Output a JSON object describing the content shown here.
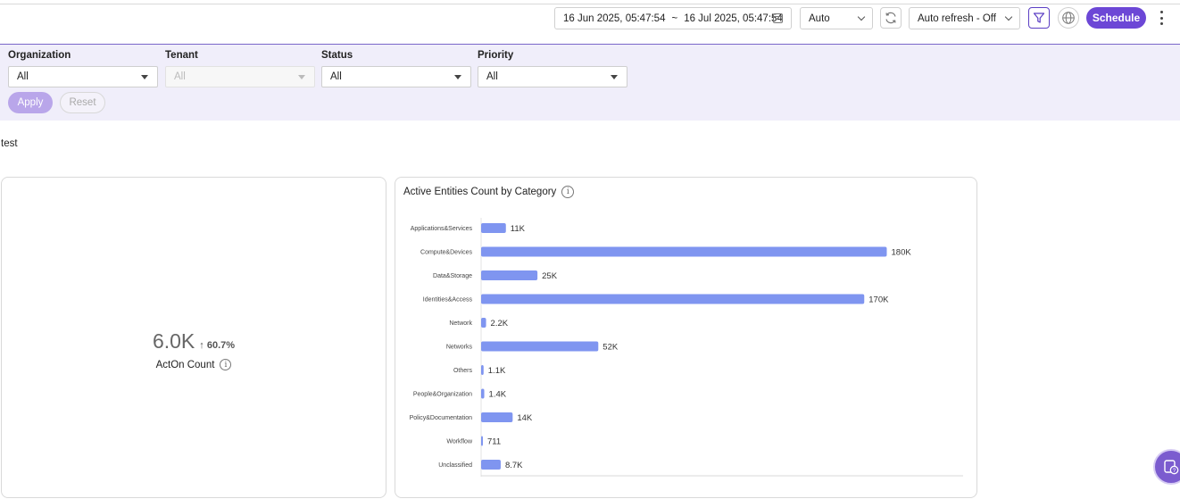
{
  "toolbar": {
    "date_from": "16 Jun 2025, 05:47:54",
    "date_sep": "~",
    "date_to": "16 Jul 2025, 05:47:54",
    "granularity": "Auto",
    "auto_refresh": "Auto refresh - Off",
    "schedule_label": "Schedule",
    "icons": [
      "calendar-icon",
      "chevron-down-icon",
      "refresh-icon",
      "filter-icon",
      "globe-icon",
      "more-vertical-icon"
    ]
  },
  "filters": {
    "organization": {
      "label": "Organization",
      "value": "All"
    },
    "tenant": {
      "label": "Tenant",
      "value": "All"
    },
    "status": {
      "label": "Status",
      "value": "All"
    },
    "priority": {
      "label": "Priority",
      "value": "All"
    },
    "apply_label": "Apply",
    "reset_label": "Reset"
  },
  "dashboard": {
    "title": "test"
  },
  "kpi": {
    "value": "6.0K",
    "delta": "60.7%",
    "label": "ActOn Count"
  },
  "chart": {
    "title": "Active Entities Count by Category",
    "bar_color": "#7f95f0"
  },
  "chart_data": {
    "type": "bar",
    "orientation": "horizontal",
    "categories": [
      "Applications&Services",
      "Compute&Devices",
      "Data&Storage",
      "Identities&Access",
      "Network",
      "Networks",
      "Others",
      "People&Organization",
      "Policy&Documentation",
      "Workflow",
      "Unclassified"
    ],
    "values": [
      11000,
      180000,
      25000,
      170000,
      2200,
      52000,
      1100,
      1400,
      14000,
      711,
      8700
    ],
    "value_labels": [
      "11K",
      "180K",
      "25K",
      "170K",
      "2.2K",
      "52K",
      "1.1K",
      "1.4K",
      "14K",
      "711",
      "8.7K"
    ],
    "xlim": [
      0,
      200000
    ],
    "grid": false
  },
  "accent_color": "#6c47d6"
}
